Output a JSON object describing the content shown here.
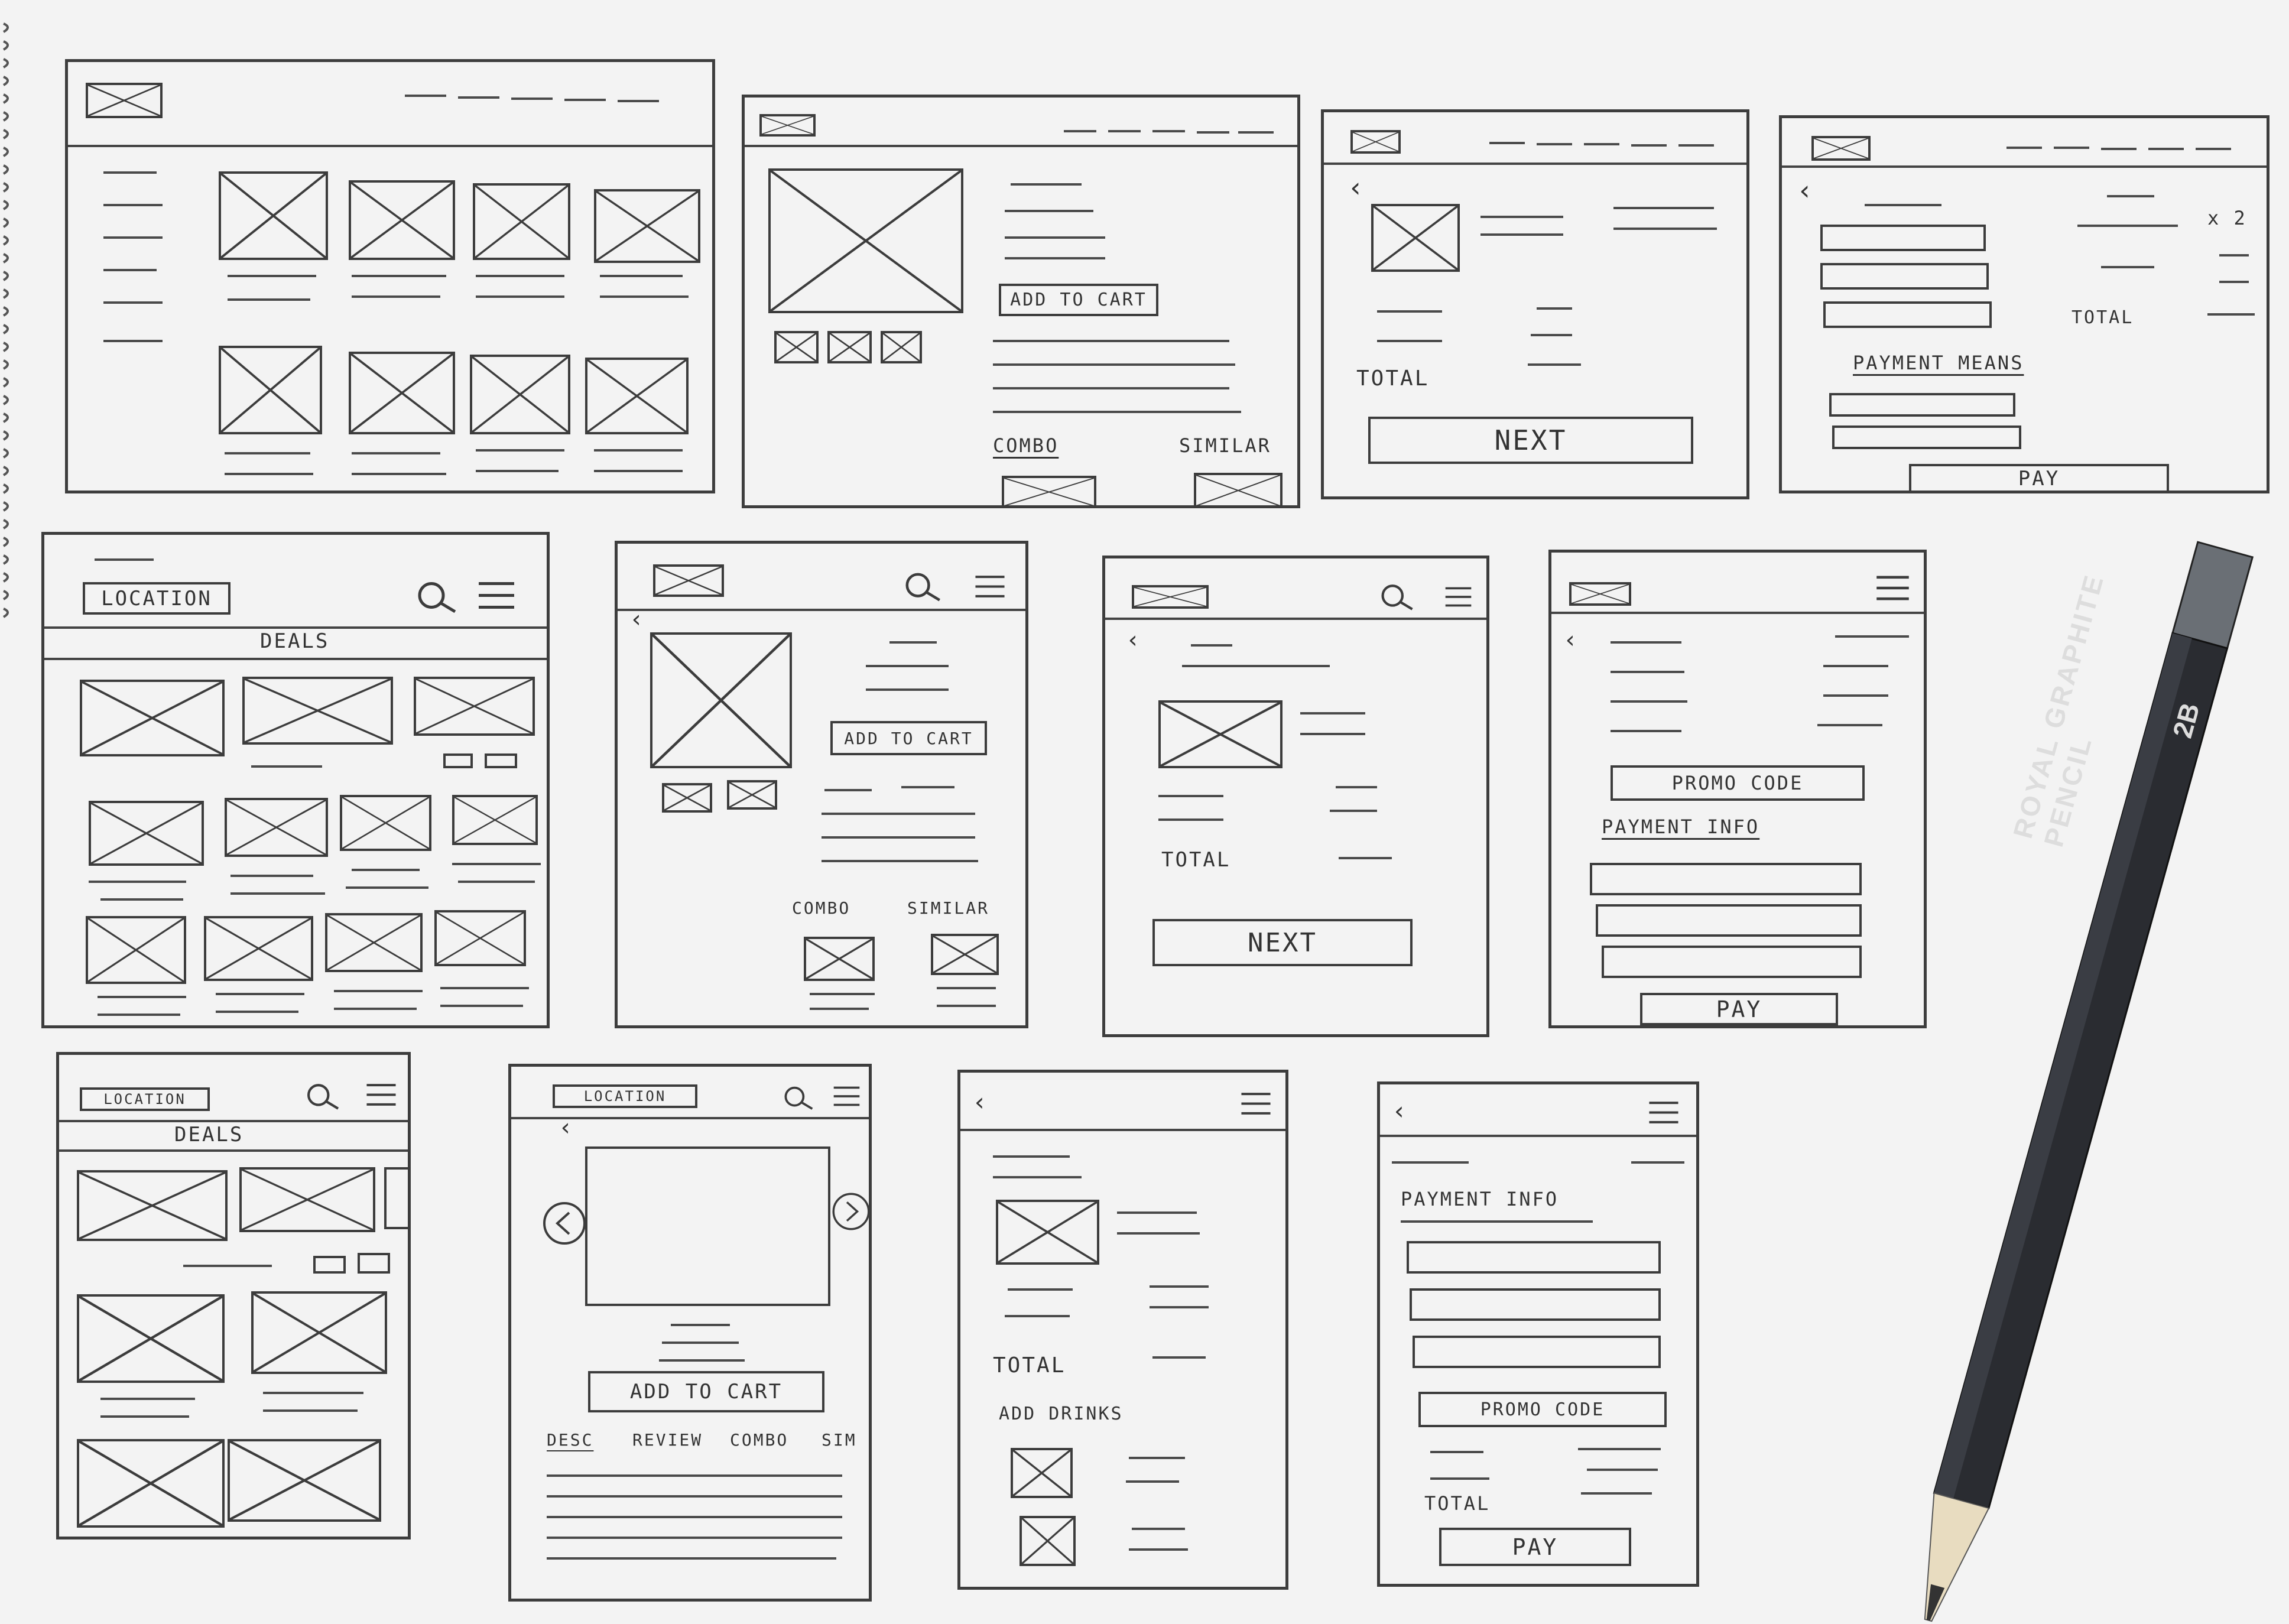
{
  "sketch": {
    "labels": {
      "add_to_cart_1": "ADD TO CART",
      "combo_1": "COMBO",
      "similar_1": "SIMILAR",
      "total_1": "TOTAL",
      "next_1": "NEXT",
      "x2": "x 2",
      "total_2": "TOTAL",
      "payment_means": "PAYMENT MEANS",
      "pay_1": "PAY",
      "location_1": "LOCATION",
      "deals_1": "DEALS",
      "add_to_cart_2": "ADD TO CART",
      "combo_2": "COMBO",
      "similar_2": "SIMILAR",
      "total_3": "TOTAL",
      "next_2": "NEXT",
      "promo_code_1": "PROMO CODE",
      "payment_info_1": "PAYMENT INFO",
      "pay_2": "PAY",
      "location_2": "LOCATION",
      "deals_2": "DEALS",
      "location_3": "LOCATION",
      "add_to_cart_3": "ADD TO CART",
      "tab_desc": "DESC",
      "tab_review": "REVIEW",
      "tab_combo": "COMBO",
      "tab_sim": "SIM",
      "total_4": "TOTAL",
      "add_drinks": "ADD DRINKS",
      "payment_info_2": "PAYMENT INFO",
      "promo_code_2": "PROMO CODE",
      "total_5": "TOTAL",
      "pay_3": "PAY"
    },
    "pencil": {
      "brand": "ROYAL GRAPHITE PENCIL",
      "grade": "2B"
    },
    "colors": {
      "ink": "#3c3c3c",
      "paper": "#f3f3f3",
      "pencil_body": "#2a2c31"
    }
  }
}
